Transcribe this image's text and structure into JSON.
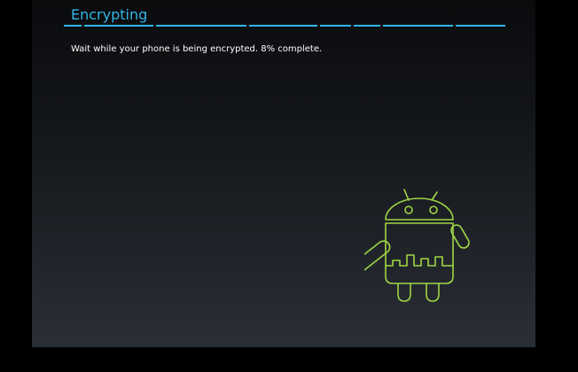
{
  "screen": {
    "title": "Encrypting",
    "message": "Wait while your phone is being encrypted. 8% complete.",
    "progress_percent": 8,
    "accent_color": "#33b5e5",
    "android_color": "#9fd645",
    "illustration_icon": "android-robot-icon"
  }
}
